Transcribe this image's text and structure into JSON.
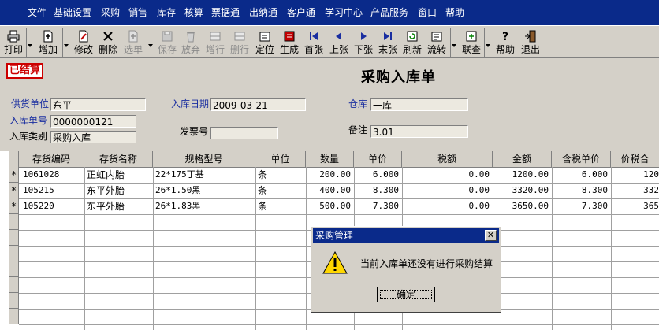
{
  "menu": [
    "文件",
    "基础设置",
    "采购",
    "销售",
    "库存",
    "核算",
    "票据通",
    "出纳通",
    "客户通",
    "学习中心",
    "产品服务",
    "窗口",
    "帮助"
  ],
  "toolbar": {
    "print": "打印",
    "add": "增加",
    "modify": "修改",
    "delete": "删除",
    "select": "选单",
    "save": "保存",
    "abandon": "放弃",
    "add_row": "增行",
    "delete_row": "删行",
    "locate": "定位",
    "generate": "生成",
    "first": "首张",
    "prev": "上张",
    "next": "下张",
    "last": "末张",
    "refresh": "刷新",
    "flow": "流转",
    "link_query": "联查",
    "help": "帮助",
    "exit": "退出"
  },
  "form": {
    "status_stamp": "已结算",
    "title": "采购入库单",
    "supplier_label": "供货单位",
    "supplier_value": "东平",
    "date_label": "入库日期",
    "date_value": "2009-03-21",
    "warehouse_label": "仓库",
    "warehouse_value": "一库",
    "doc_no_label": "入库单号",
    "doc_no_value": "0000000121",
    "invoice_label": "发票号",
    "invoice_value": "",
    "remark_label": "备注",
    "remark_value": "3.01",
    "type_label": "入库类别",
    "type_value": "采购入库"
  },
  "table": {
    "headers": [
      "存货编码",
      "存货名称",
      "规格型号",
      "单位",
      "数量",
      "单价",
      "税额",
      "金额",
      "含税单价",
      "价税合"
    ],
    "rows": [
      {
        "mark": "*",
        "code": "1061028",
        "name": "正虹内胎",
        "spec": "22*175丁基",
        "unit": "条",
        "qty": "200.00",
        "price": "6.000",
        "tax": "0.00",
        "amount": "1200.00",
        "tax_price": "6.000",
        "total": "120"
      },
      {
        "mark": "*",
        "code": "105215",
        "name": "东平外胎",
        "spec": "26*1.50黑",
        "unit": "条",
        "qty": "400.00",
        "price": "8.300",
        "tax": "0.00",
        "amount": "3320.00",
        "tax_price": "8.300",
        "total": "332"
      },
      {
        "mark": "*",
        "code": "105220",
        "name": "东平外胎",
        "spec": "26*1.83黑",
        "unit": "条",
        "qty": "500.00",
        "price": "7.300",
        "tax": "0.00",
        "amount": "3650.00",
        "tax_price": "7.300",
        "total": "365"
      }
    ]
  },
  "dialog": {
    "title": "采购管理",
    "message": "当前入库单还没有进行采购结算",
    "ok": "确定"
  },
  "icons": {
    "warning": "warning-icon",
    "close": "close-icon"
  },
  "colors": {
    "menubar": "#0a2a8a",
    "face": "#d4d0c8",
    "label_blue": "#1a2ea0",
    "stamp_red": "#cc0000"
  }
}
